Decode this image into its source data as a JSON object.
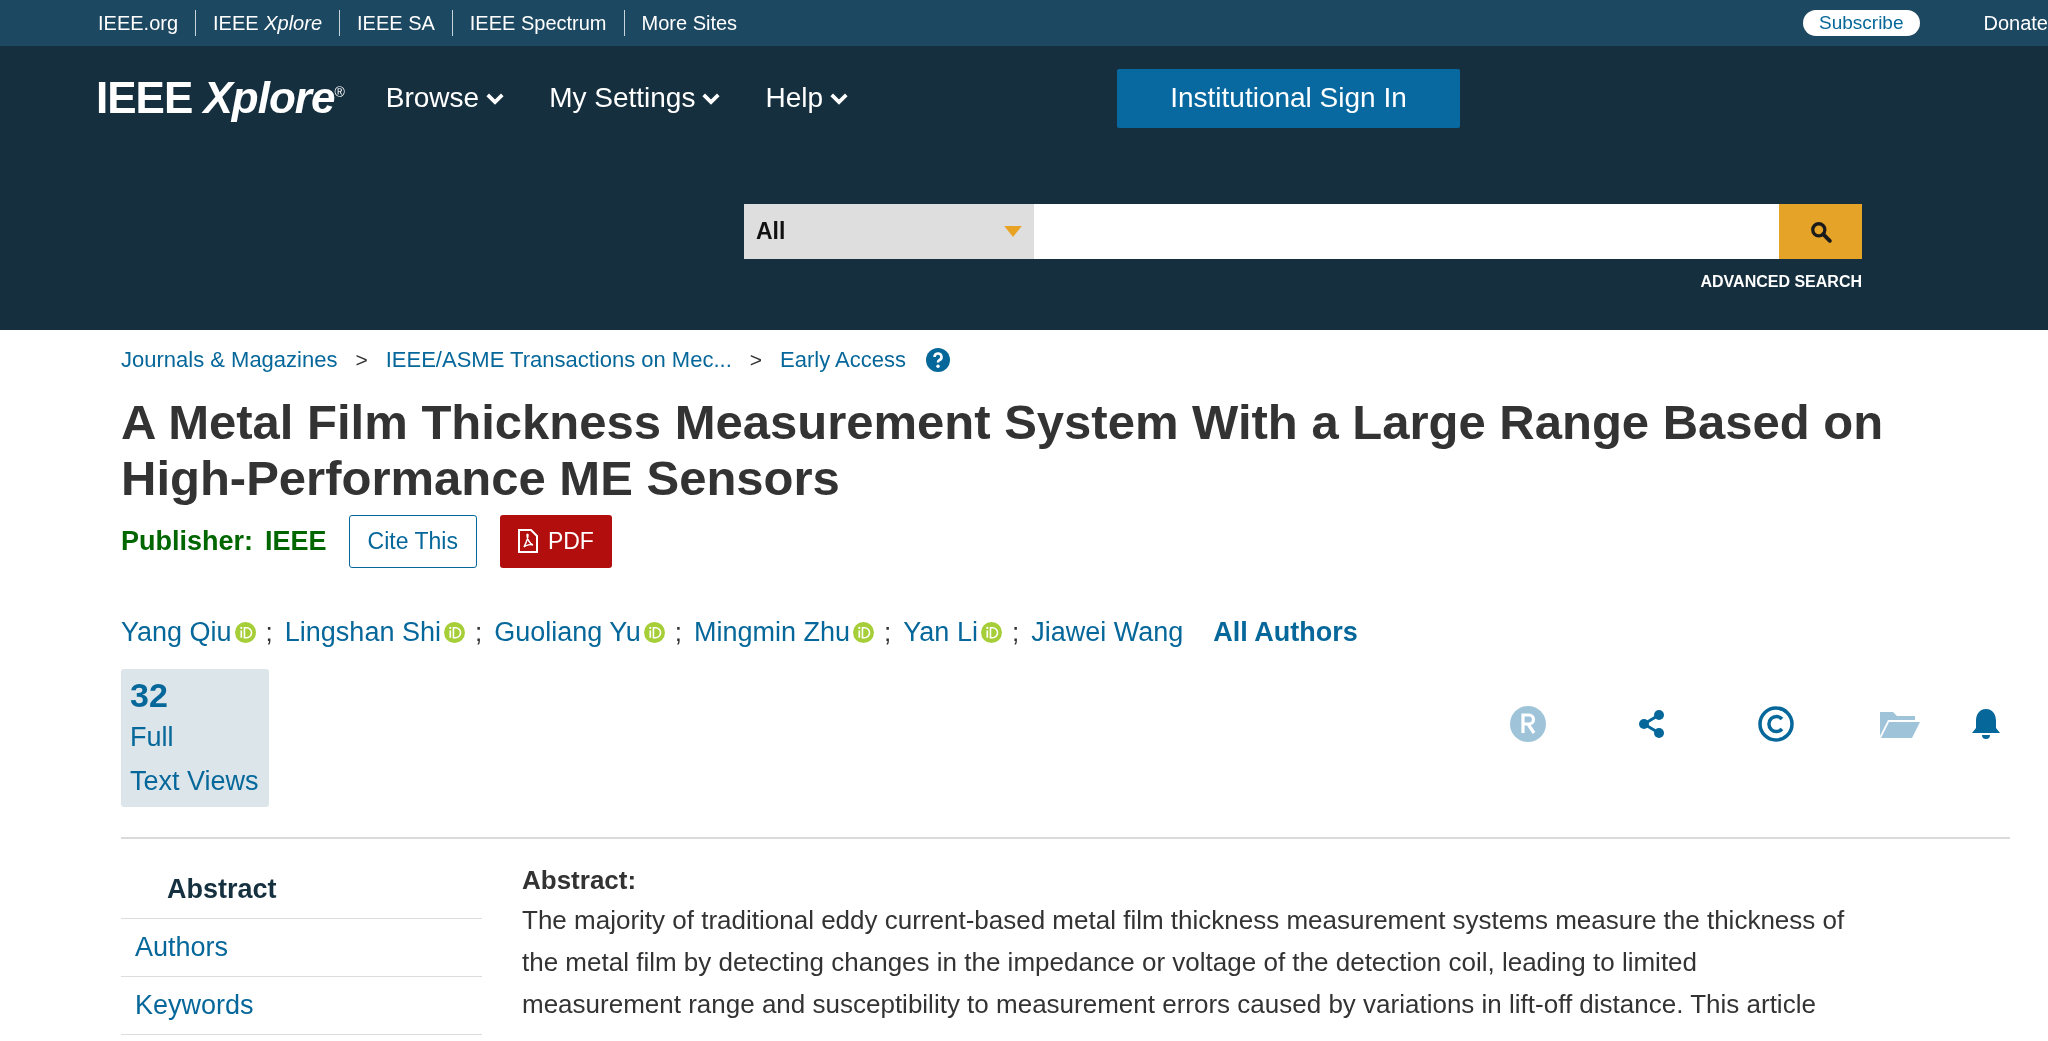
{
  "top_bar": {
    "links": [
      "IEEE.org",
      "IEEE *Xplore*",
      "IEEE SA",
      "IEEE Spectrum",
      "More Sites"
    ],
    "subscribe": "Subscribe",
    "donate": "Donate"
  },
  "header": {
    "logo": "IEEE *Xplore*$^{®}$",
    "nav": [
      "Browse",
      "My Settings",
      "Help"
    ],
    "sign_in": "Institutional Sign In"
  },
  "search": {
    "scope": "All",
    "advanced": "ADVANCED SEARCH"
  },
  "breadcrumb": {
    "separator": ">",
    "items": [
      "Journals & Magazines",
      "IEEE/ASME Transactions on Mec...",
      "Early Access"
    ]
  },
  "title": "A Metal Film Thickness Measurement System With a Large Range Based on High-Performance ME Sensors",
  "publisher": {
    "label": "Publisher:",
    "value": "IEEE"
  },
  "buttons": [
    {
      "kind": "cite",
      "label": "Cite This"
    },
    {
      "kind": "pdf",
      "label": "PDF"
    }
  ],
  "authors": [
    {
      "name": "Yang Qiu",
      "orcid": true
    },
    {
      "name": "Lingshan Shi",
      "orcid": true
    },
    {
      "name": "Guoliang Yu",
      "orcid": true
    },
    {
      "name": "Mingmin Zhu",
      "orcid": true
    },
    {
      "name": "Yan Li",
      "orcid": true
    },
    {
      "name": "Jiawei Wang",
      "orcid": false
    }
  ],
  "author_separator": ";",
  "all_authors": "All Authors",
  "metric": {
    "count": "32",
    "label_lines": [
      "Full",
      "Text Views"
    ]
  },
  "actions": [
    {
      "kind": "rights",
      "disabled": true
    },
    {
      "kind": "share",
      "disabled": false
    },
    {
      "kind": "copyright",
      "disabled": false
    },
    {
      "kind": "folder",
      "disabled": true
    },
    {
      "kind": "alert",
      "disabled": false
    }
  ],
  "sidebar": [
    {
      "label": "Abstract",
      "selected": true
    },
    {
      "label": "Authors",
      "selected": false
    },
    {
      "label": "Keywords",
      "selected": false
    }
  ],
  "abstract": {
    "heading": "Abstract:",
    "lines": [
      "The majority of traditional eddy current-based metal film thickness measurement systems measure the thickness of",
      "the metal film by detecting changes in the impedance or voltage of the detection coil, leading to limited",
      "measurement range and susceptibility to measurement errors caused by variations in lift-off distance. This article"
    ]
  }
}
